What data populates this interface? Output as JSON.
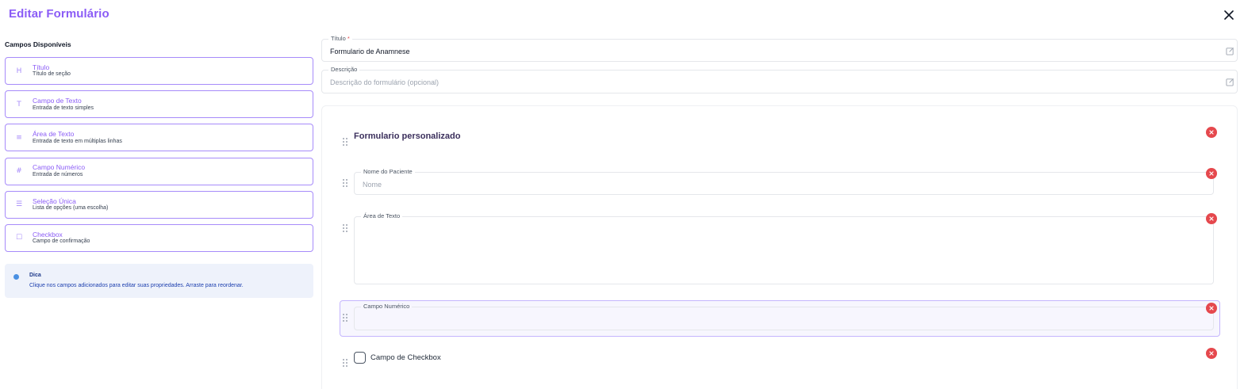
{
  "header": {
    "title": "Editar Formulário"
  },
  "sidebar": {
    "heading": "Campos Disponíveis",
    "fields": [
      {
        "icon": "H",
        "icon_name": "heading-icon",
        "name": "Título",
        "desc": "Título de seção"
      },
      {
        "icon": "T",
        "icon_name": "text-icon",
        "name": "Campo de Texto",
        "desc": "Entrada de texto simples"
      },
      {
        "icon": "≡",
        "icon_name": "align-left-icon",
        "name": "Área de Texto",
        "desc": "Entrada de texto em múltiplas linhas"
      },
      {
        "icon": "#",
        "icon_name": "hash-icon",
        "name": "Campo Numérico",
        "desc": "Entrada de números"
      },
      {
        "icon": "☰",
        "icon_name": "list-icon",
        "name": "Seleção Única",
        "desc": "Lista de opções (uma escolha)"
      },
      {
        "icon": "☐",
        "icon_name": "checkbox-icon",
        "name": "Checkbox",
        "desc": "Campo de confirmação"
      }
    ],
    "tip": {
      "title": "Dica",
      "text": "Clique nos campos adicionados para editar suas propriedades. Arraste para reordenar."
    }
  },
  "form": {
    "title_label": "Título",
    "required_mark": "*",
    "title_value": "Formulario de Anamnese",
    "description_label": "Descrição",
    "description_placeholder": "Descrição do formulário (opcional)"
  },
  "canvas": {
    "section_title": "Formulario personalizado",
    "patient_field": {
      "label": "Nome do Paciente",
      "placeholder": "Nome"
    },
    "textarea_field": {
      "label": "Área de Texto"
    },
    "number_field": {
      "label": "Campo Numérico"
    },
    "checkbox_field": {
      "label": "Campo de Checkbox"
    }
  },
  "colors": {
    "accent": "#8b5cf6",
    "card_border": "#a78bfa",
    "delete": "#e5484d",
    "tip_bg": "#eef2fb",
    "tip_dot": "#4a90e2"
  }
}
